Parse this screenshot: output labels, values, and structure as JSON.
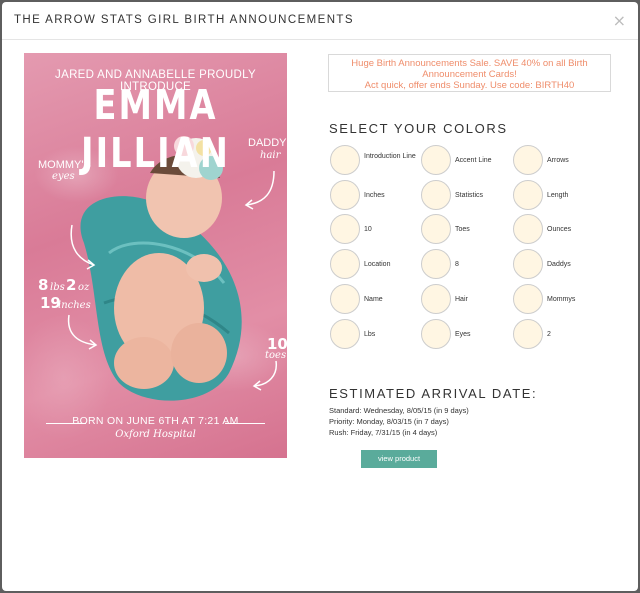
{
  "modal": {
    "title": "THE ARROW STATS GIRL BIRTH ANNOUNCEMENTS",
    "close_icon": "close-icon",
    "close_glyph": "×"
  },
  "photo": {
    "intro": "JARED AND ANNABELLE PROUDLY INTRODUCE",
    "name": "EMMA JILLIAN",
    "mommys": "MOMMY'S",
    "mommys_script": "eyes",
    "daddys": "DADDY'S",
    "daddys_script": "hair",
    "lbs_num": "8",
    "lbs_script": "lbs",
    "oz_num": "2",
    "oz_script": "oz",
    "inches_num": "19",
    "inches_script": "inches",
    "toes_num": "10",
    "toes_script": "toes",
    "born": "BORN ON JUNE 6TH AT 7:21 AM",
    "hospital": "Oxford Hospital"
  },
  "sale": {
    "line1": "Huge Birth Announcements Sale. SAVE 40% on all Birth",
    "line2": "Announcement Cards!",
    "line3": "Act quick, offer ends Sunday. Use code: BIRTH40"
  },
  "colors": {
    "title": "SELECT YOUR COLORS",
    "swatch_color": "#fff6e3",
    "items": [
      "Introduction Line",
      "Accent Line",
      "Arrows",
      "Inches",
      "Statistics",
      "Length",
      "10",
      "Toes",
      "Ounces",
      "Location",
      "8",
      "Daddys",
      "Name",
      "Hair",
      "Mommys",
      "Lbs",
      "Eyes",
      "2"
    ]
  },
  "arrival": {
    "title": "ESTIMATED ARRIVAL DATE:",
    "standard": "Standard: Wednesday, 8/05/15 (in 9 days)",
    "priority": "Priority: Monday, 8/03/15 (in 7 days)",
    "rush": "Rush: Friday, 7/31/15 (in 4 days)"
  },
  "buttons": {
    "view_product": "view product",
    "accent": "#5aab9b"
  }
}
